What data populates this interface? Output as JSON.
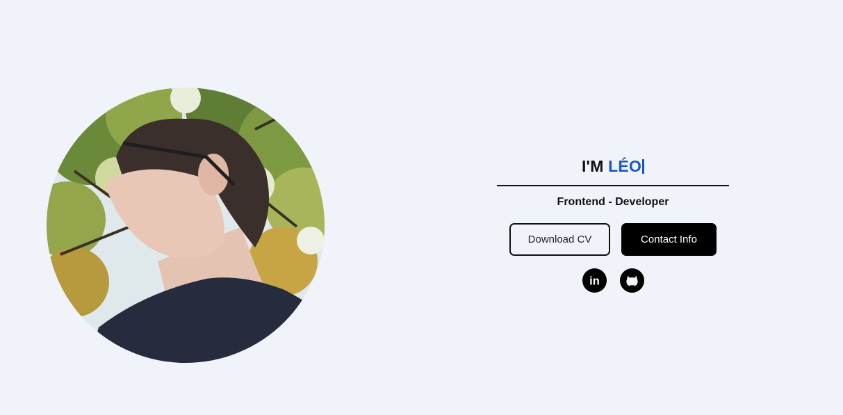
{
  "portrait": {
    "alt": "Portrait of Léo looking up under a tree"
  },
  "hero": {
    "prefix": "I'M ",
    "name": "LÉO",
    "role": "Frontend - Developer"
  },
  "buttons": {
    "download_cv": "Download CV",
    "contact_info": "Contact Info"
  },
  "socials": [
    {
      "icon": "linkedin-icon",
      "label": "in"
    },
    {
      "icon": "github-icon"
    }
  ],
  "colors": {
    "background": "#f0f3f9",
    "accent": "#1a56c4",
    "text": "#111111",
    "button_dark": "#000000"
  }
}
